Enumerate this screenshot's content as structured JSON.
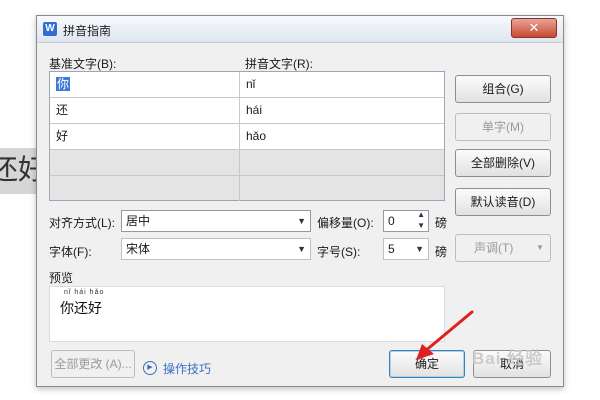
{
  "background": {
    "doc_text": "还好"
  },
  "dialog": {
    "title": "拼音指南",
    "close": "✕",
    "app_icon": "W"
  },
  "table": {
    "base_header": "基准文字(B):",
    "pinyin_header": "拼音文字(R):",
    "rows": [
      {
        "base": "你",
        "pinyin": "nǐ"
      },
      {
        "base": "还",
        "pinyin": "hái"
      },
      {
        "base": "好",
        "pinyin": "hǎo"
      },
      {
        "base": "",
        "pinyin": ""
      },
      {
        "base": "",
        "pinyin": ""
      }
    ]
  },
  "side_buttons": {
    "group": "组合(G)",
    "single": "单字(M)",
    "delete_all": "全部删除(V)",
    "default_reading": "默认读音(D)",
    "tone": "声调(T)"
  },
  "options": {
    "align_label": "对齐方式(L):",
    "align_value": "居中",
    "offset_label": "偏移量(O):",
    "offset_value": "0",
    "offset_unit": "磅",
    "font_label": "字体(F):",
    "font_value": "宋体",
    "size_label": "字号(S):",
    "size_value": "5",
    "size_unit": "磅"
  },
  "preview": {
    "label": "预览",
    "pinyin": "nǐ hái hǎo",
    "text": "你还好"
  },
  "footer": {
    "change_all": "全部更改 (A)...",
    "tips": "操作技巧",
    "ok": "确定",
    "cancel": "取消"
  },
  "watermark": "Bai 经验",
  "colors": {
    "annotation": "#e02020",
    "link": "#3b6fc4",
    "selection": "#3d7bd8"
  }
}
